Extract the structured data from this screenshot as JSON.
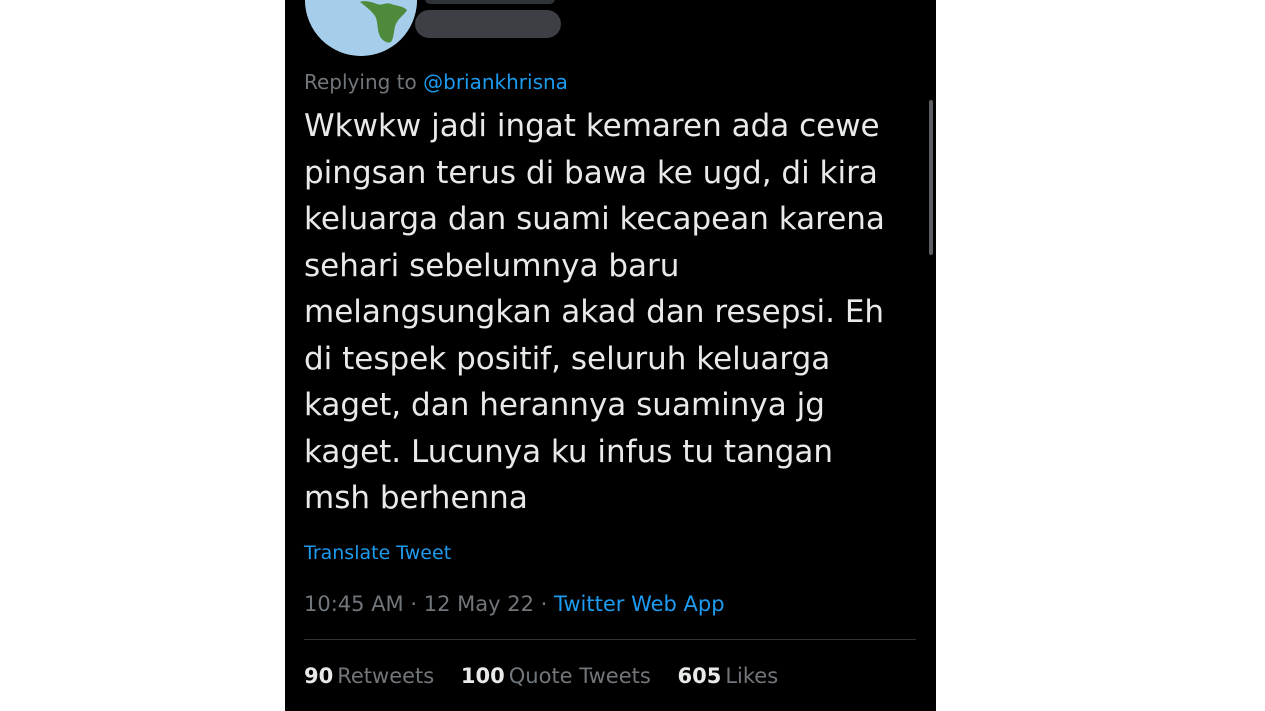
{
  "reply": {
    "prefix": "Replying to",
    "handle": "@briankhrisna"
  },
  "tweet": {
    "lines": [
      "Wkwkw jadi ingat kemaren ada cewe",
      "pingsan terus di bawa ke ugd, di kira",
      "keluarga dan suami kecapean karena",
      "sehari sebelumnya baru",
      "melangsungkan akad dan resepsi. Eh",
      "di tespek positif, seluruh keluarga",
      "kaget, dan herannya suaminya jg",
      "kaget.  Lucunya ku infus tu tangan",
      "msh berhenna"
    ],
    "translate_label": "Translate Tweet"
  },
  "meta": {
    "time": "10:45 AM",
    "date": "12 May 22",
    "separator": "·",
    "source": "Twitter Web App"
  },
  "stats": {
    "retweets_count": "90",
    "retweets_label": "Retweets",
    "quotes_count": "100",
    "quotes_label": "Quote Tweets",
    "likes_count": "605",
    "likes_label": "Likes"
  },
  "colors": {
    "background": "#000000",
    "text": "#e7e9ea",
    "secondary": "#71767b",
    "accent": "#1d9bf0"
  },
  "icons": {
    "avatar": "globe-avatar"
  }
}
